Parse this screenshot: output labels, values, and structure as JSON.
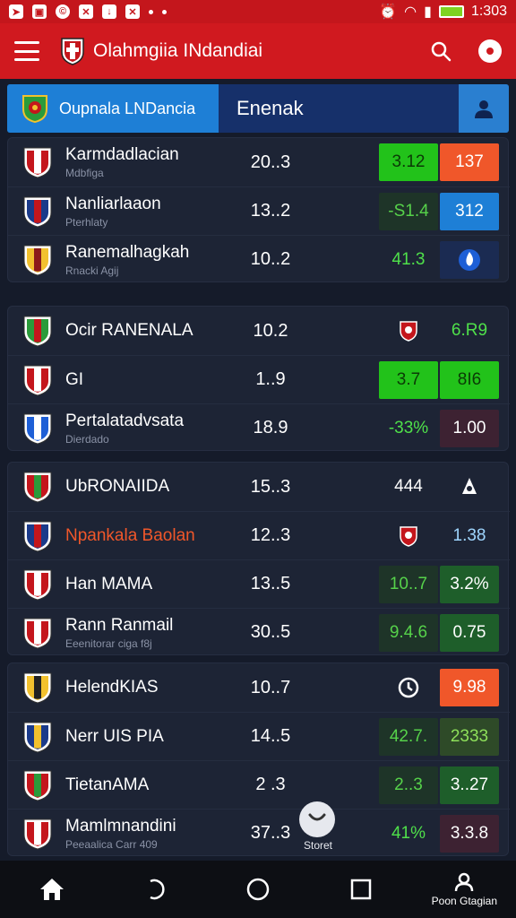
{
  "status_bar": {
    "time": "1:303"
  },
  "app_bar": {
    "title": "Olahmgiia INdandiai"
  },
  "tabs": {
    "active_label": "Oupnala LNDancia",
    "second_label": "Enenak"
  },
  "colors": {
    "red": "#d0191f",
    "blue": "#1e7fd6",
    "green": "#22c21a",
    "orange": "#f0572a",
    "dark_green": "#1e5e2a",
    "dark_red": "#3d2232"
  },
  "groups": [
    {
      "rows": [
        {
          "name": "Karmdadlacian",
          "sub": "Mdbfiga",
          "score": "20..3",
          "v1": "3.12",
          "v1_style": "green",
          "v2": "137",
          "v2_style": "orange"
        },
        {
          "name": "Nanliarlaaon",
          "sub": "Pterhlaty",
          "score": "13..2",
          "v1": "-S1.4",
          "v1_style": "dim-green",
          "v2": "312",
          "v2_style": "blue"
        },
        {
          "name": "Ranemalhagkah",
          "sub": "Rnacki Agij",
          "score": "10..2",
          "v1": "41.3",
          "v1_style": "text-green",
          "v2": "",
          "v2_icon": "flame-icon",
          "v2_style": "dark-blue"
        }
      ]
    },
    {
      "rows": [
        {
          "name": "Ocir RANENALA",
          "sub": "",
          "score": "10.2",
          "v1": "",
          "v1_icon": "crest-icon",
          "v1_style": "none",
          "v2": "6.R9",
          "v2_style": "text-green"
        },
        {
          "name": "GI",
          "sub": "",
          "score": "1..9",
          "v1": "3.7",
          "v1_style": "green",
          "v2": "8I6",
          "v2_style": "green"
        },
        {
          "name": "Pertalatadvsata",
          "sub": "Dierdado",
          "score": "18.9",
          "v1": "-33%",
          "v1_style": "text-green",
          "v2": "1.00",
          "v2_style": "dark-red"
        }
      ]
    },
    {
      "rows": [
        {
          "name": "UbRONAIIDA",
          "sub": "",
          "score": "15..3",
          "v1": "444",
          "v1_style": "white",
          "v2": "",
          "v2_icon": "club-icon",
          "v2_style": "none"
        },
        {
          "name": "Npankala Baolan",
          "sub": "",
          "score": "12..3",
          "v1": "",
          "v1_icon": "crest-icon",
          "v1_style": "none",
          "v2": "1.38",
          "v2_style": "text-blue"
        },
        {
          "name": "Han MAMA",
          "sub": "",
          "score": "13..5",
          "v1": "10..7",
          "v1_style": "dim-green",
          "v2": "3.2%",
          "v2_style": "dark-green"
        },
        {
          "name": "Rann Ranmail",
          "sub": "Eeenitorar ciga f8j",
          "score": "30..5",
          "v1": "9.4.6",
          "v1_style": "dim-green",
          "v2": "0.75",
          "v2_style": "dark-green"
        }
      ]
    },
    {
      "rows": [
        {
          "name": "HelendKIAS",
          "sub": "",
          "score": "10..7",
          "v1": "",
          "v1_icon": "clock-icon",
          "v1_style": "none",
          "v2": "9.98",
          "v2_style": "orange"
        },
        {
          "name": "Nerr UIS PIA",
          "sub": "",
          "score": "14..5",
          "v1": "42.7.",
          "v1_style": "dim-green",
          "v2": "2333",
          "v2_style": "olive"
        },
        {
          "name": "TietanAMA",
          "sub": "",
          "score": "2 .3",
          "v1": "2..3",
          "v1_style": "dim-green",
          "v2": "3..27",
          "v2_style": "dark-green"
        },
        {
          "name": "Mamlmnandini",
          "sub": "Peeaalica Carr 409",
          "score": "37..3",
          "v1": "41%",
          "v1_style": "text-green",
          "v2": "3.3.8",
          "v2_style": "dark-red"
        }
      ]
    }
  ],
  "fab": {
    "label": "Storet"
  },
  "nav": {
    "profile_label": "Poon Gtagian"
  }
}
